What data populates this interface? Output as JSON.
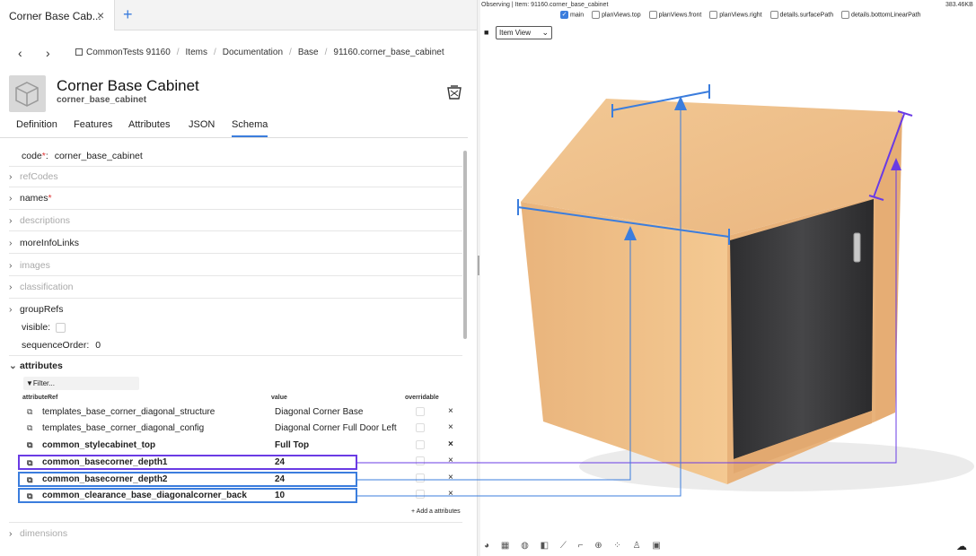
{
  "tab": {
    "title": "Corner Base Cab...",
    "close": "×",
    "add": "+"
  },
  "nav": {
    "back": "‹",
    "forward": "›"
  },
  "breadcrumb": [
    {
      "label": "CommonTests 91160"
    },
    {
      "label": "Items"
    },
    {
      "label": "Documentation"
    },
    {
      "label": "Base"
    },
    {
      "label": "91160.corner_base_cabinet"
    }
  ],
  "item": {
    "title": "Corner Base Cabinet",
    "code": "corner_base_cabinet"
  },
  "tabs": [
    "Definition",
    "Features",
    "Attributes",
    "JSON",
    "Schema"
  ],
  "active_tab": "Schema",
  "schema": {
    "code_label": "code",
    "code_required": "*",
    "code_value": "corner_base_cabinet",
    "sections": {
      "refCodes": "refCodes",
      "names": "names",
      "descriptions": "descriptions",
      "moreInfoLinks": "moreInfoLinks",
      "images": "images",
      "classification": "classification",
      "groupRefs": "groupRefs"
    },
    "visible_label": "visible:",
    "sequence_label": "sequenceOrder:",
    "sequence_value": "0",
    "attributes_label": "attributes",
    "filter_placeholder": "Filter...",
    "columns": {
      "ref": "attributeRef",
      "value": "value",
      "overridable": "overridable"
    },
    "attributes": [
      {
        "ref": "templates_base_corner_diagonal_structure",
        "value": "Diagonal Corner Base",
        "bold": false
      },
      {
        "ref": "templates_base_corner_diagonal_config",
        "value": "Diagonal Corner Full Door Left",
        "bold": false
      },
      {
        "ref": "common_stylecabinet_top",
        "value": "Full Top",
        "bold": true
      },
      {
        "ref": "common_basecorner_depth1",
        "value": "24",
        "bold": true
      },
      {
        "ref": "common_basecorner_depth2",
        "value": "24",
        "bold": true
      },
      {
        "ref": "common_clearance_base_diagonalcorner_back",
        "value": "10",
        "bold": true
      }
    ],
    "remove_icon": "×",
    "add_attributes": "+ Add a attributes",
    "dimensions": "dimensions"
  },
  "viewer": {
    "observing": "Observing | Item: 91160.corner_base_cabinet",
    "size": "383.46KB",
    "views": [
      {
        "label": "main",
        "checked": true
      },
      {
        "label": "planViews.top",
        "checked": false
      },
      {
        "label": "planViews.front",
        "checked": false
      },
      {
        "label": "planViews.right",
        "checked": false
      },
      {
        "label": "details.surfacePath",
        "checked": false
      },
      {
        "label": "details.bottomLinearPath",
        "checked": false
      }
    ],
    "view_mode": "Item View",
    "colors": {
      "highlight_depth1": "#6a3be4",
      "highlight_blue": "#3b7ddd",
      "cabinet_body": "#f0c38e",
      "door": "#3a3a3c"
    }
  }
}
